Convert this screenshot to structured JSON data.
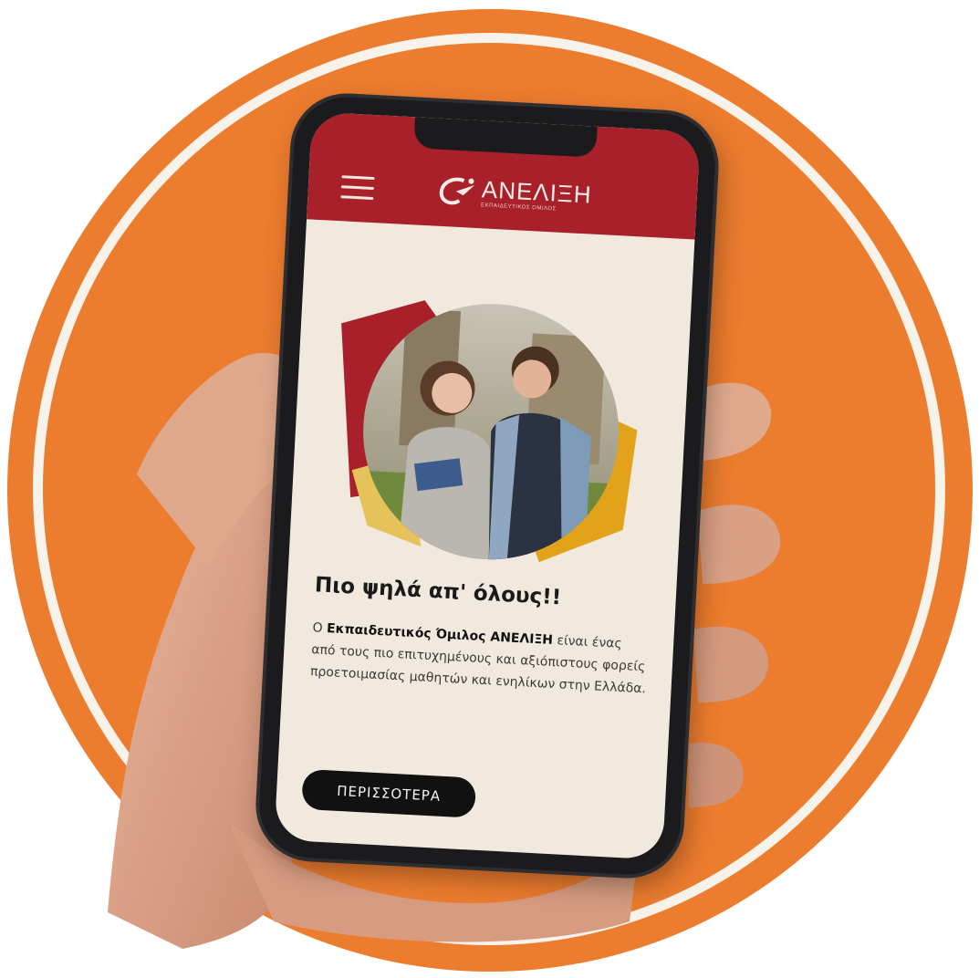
{
  "colors": {
    "background_orange": "#ec7c2e",
    "ring": "#f7f2ea",
    "header_red": "#a8202a",
    "screen_bg": "#f1e9de",
    "button_black": "#111111",
    "accent_yellow": "#e2a21a"
  },
  "header": {
    "menu_icon": "hamburger-icon",
    "logo_name": "ΑΝΕΛΙΞΗ",
    "logo_subtitle": "ΕΚΠΑΙΔΕΥΤΙΚΟΣ ΟΜΙΛΟΣ"
  },
  "hero": {
    "image": "students-photo"
  },
  "content": {
    "headline": "Πιο ψηλά απ' όλους!!",
    "paragraph_prefix": "Ο ",
    "paragraph_bold": "Εκπαιδευτικός Όμιλος ΑΝΕΛΙΞΗ",
    "paragraph_rest": " είναι ένας από τους πιο επιτυχημένους και αξιόπιστους φορείς προετοιμασίας μαθητών και ενηλίκων στην Ελλάδα.",
    "cta_label": "ΠΕΡΙΣΣΟΤΕΡΑ"
  }
}
